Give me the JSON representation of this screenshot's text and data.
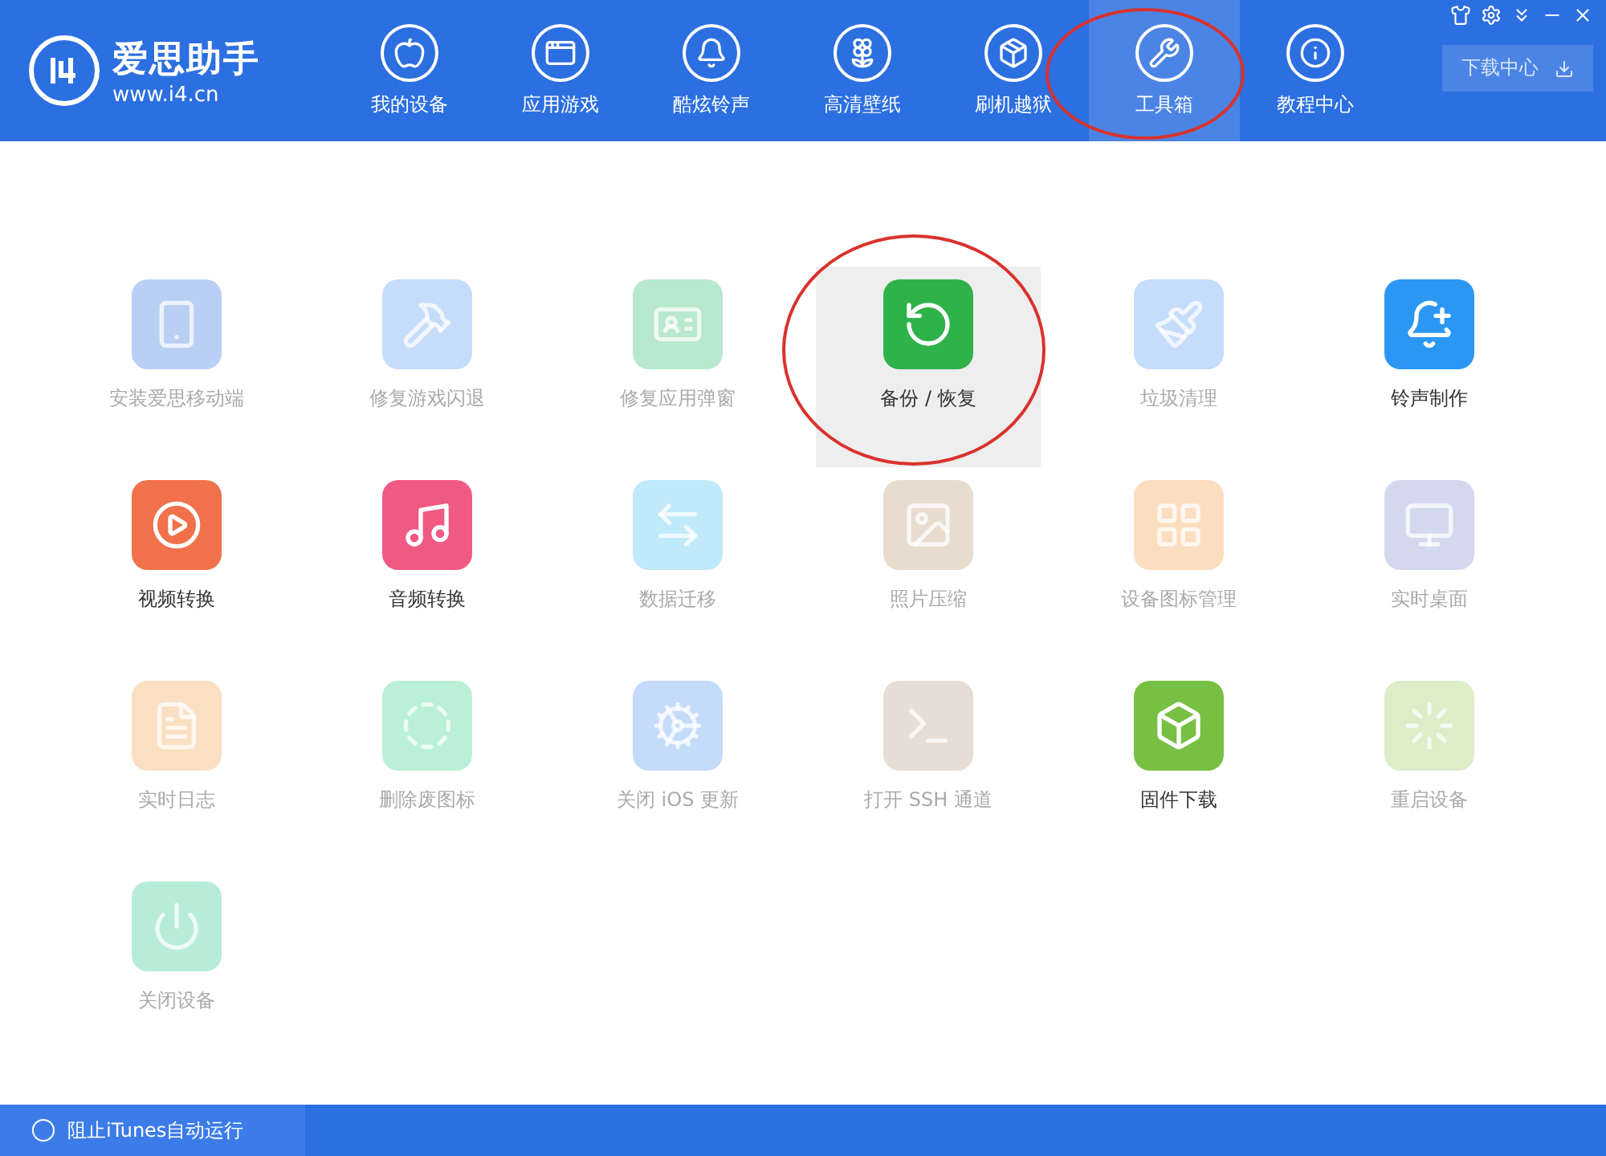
{
  "app": {
    "name": "爱思助手",
    "url": "www.i4.cn"
  },
  "nav": [
    {
      "label": "我的设备",
      "selected": false
    },
    {
      "label": "应用游戏",
      "selected": false
    },
    {
      "label": "酷炫铃声",
      "selected": false
    },
    {
      "label": "高清壁纸",
      "selected": false
    },
    {
      "label": "刷机越狱",
      "selected": false
    },
    {
      "label": "工具箱",
      "selected": true
    },
    {
      "label": "教程中心",
      "selected": false
    }
  ],
  "download_button": "下载中心",
  "tools": [
    {
      "label": "安装爱思移动端",
      "disabled": true,
      "selected": false,
      "color": "#b9d0f4"
    },
    {
      "label": "修复游戏闪退",
      "disabled": true,
      "selected": false,
      "color": "#c6dcfb"
    },
    {
      "label": "修复应用弹窗",
      "disabled": true,
      "selected": false,
      "color": "#b8e8cd"
    },
    {
      "label": "备份 / 恢复",
      "disabled": false,
      "selected": true,
      "color": "#2fb24a"
    },
    {
      "label": "垃圾清理",
      "disabled": true,
      "selected": false,
      "color": "#c5dcfa"
    },
    {
      "label": "铃声制作",
      "disabled": false,
      "selected": false,
      "color": "#2b97f3"
    },
    {
      "label": "视频转换",
      "disabled": false,
      "selected": false,
      "color": "#f0714a"
    },
    {
      "label": "音频转换",
      "disabled": false,
      "selected": false,
      "color": "#f05a82"
    },
    {
      "label": "数据迁移",
      "disabled": true,
      "selected": false,
      "color": "#c0eaf9"
    },
    {
      "label": "照片压缩",
      "disabled": true,
      "selected": false,
      "color": "#e8dccf"
    },
    {
      "label": "设备图标管理",
      "disabled": true,
      "selected": false,
      "color": "#fbddc0"
    },
    {
      "label": "实时桌面",
      "disabled": true,
      "selected": false,
      "color": "#d3d8ee"
    },
    {
      "label": "实时日志",
      "disabled": true,
      "selected": false,
      "color": "#fbdfc2"
    },
    {
      "label": "删除废图标",
      "disabled": true,
      "selected": false,
      "color": "#b9f0d6"
    },
    {
      "label": "关闭 iOS 更新",
      "disabled": true,
      "selected": false,
      "color": "#c4dbfa"
    },
    {
      "label": "打开 SSH 通道",
      "disabled": true,
      "selected": false,
      "color": "#e6ddd4"
    },
    {
      "label": "固件下载",
      "disabled": false,
      "selected": false,
      "color": "#78c043"
    },
    {
      "label": "重启设备",
      "disabled": true,
      "selected": false,
      "color": "#dcedc8"
    },
    {
      "label": "关闭设备",
      "disabled": true,
      "selected": false,
      "color": "#b7ecd8"
    }
  ],
  "status_bar": {
    "option": {
      "label": "阻止iTunes自动运行",
      "checked": false
    }
  }
}
